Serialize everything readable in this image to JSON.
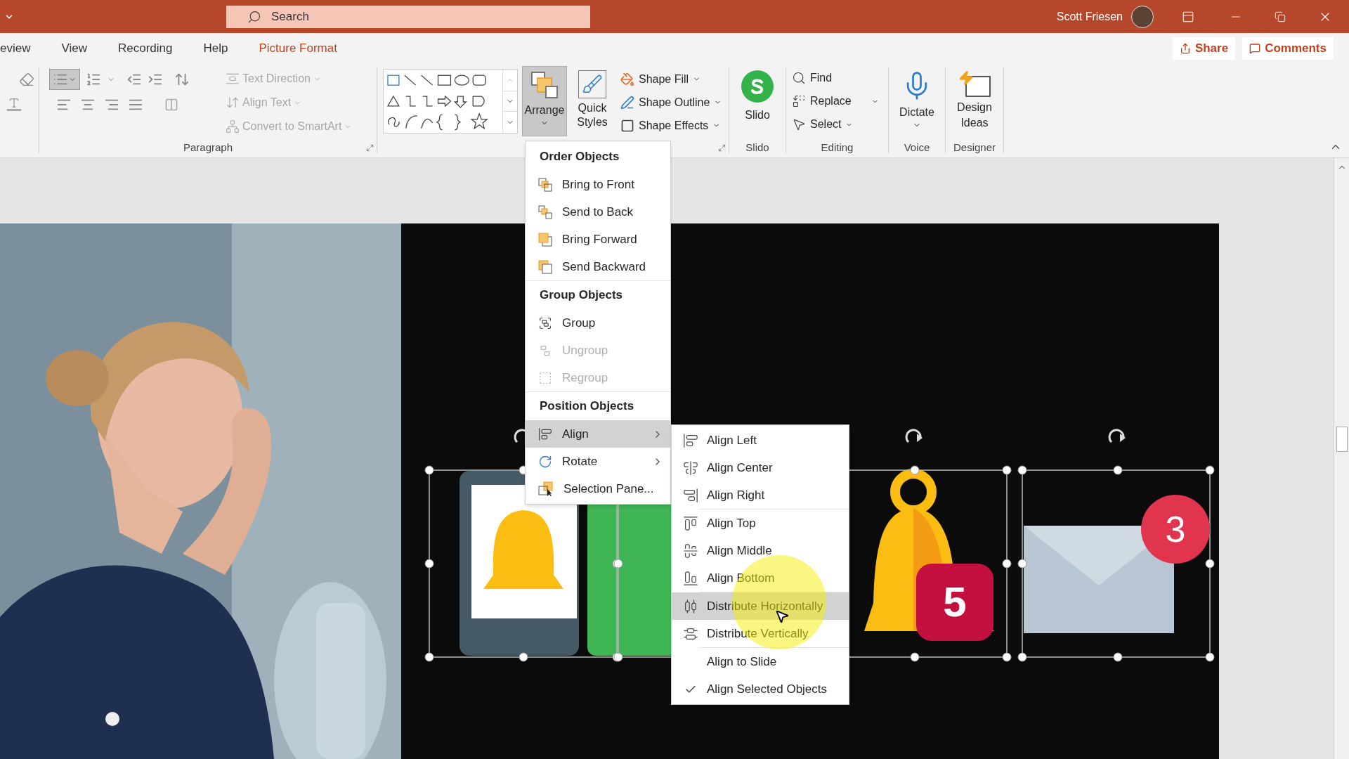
{
  "title_bar": {
    "search": {
      "placeholder": "Search"
    },
    "user_name": "Scott Friesen"
  },
  "tabs": [
    {
      "label": "eview",
      "selected": false
    },
    {
      "label": "View",
      "selected": false
    },
    {
      "label": "Recording",
      "selected": false
    },
    {
      "label": "Help",
      "selected": false
    },
    {
      "label": "Picture Format",
      "selected": true
    }
  ],
  "share_button": "Share",
  "comments_button": "Comments",
  "ribbon": {
    "paragraph": {
      "label": "Paragraph",
      "bullets": {
        "on": true
      },
      "commands": [
        {
          "label": "Text Direction",
          "disabled": true
        },
        {
          "label": "Align Text",
          "disabled": true
        },
        {
          "label": "Convert to SmartArt",
          "disabled": true
        }
      ]
    },
    "drawing": {
      "arrange": {
        "label": "Arrange",
        "expanded": true
      },
      "quick_styles": "Quick Styles",
      "shape_commands": [
        "Shape Fill",
        "Shape Outline",
        "Shape Effects"
      ]
    },
    "slido": {
      "button": "Slido",
      "label": "Slido"
    },
    "editing": {
      "commands": [
        "Find",
        "Replace",
        "Select"
      ],
      "label": "Editing"
    },
    "voice": {
      "button": "Dictate",
      "label": "Voice"
    },
    "designer": {
      "button": "Design Ideas",
      "label": "Designer"
    }
  },
  "slide": {
    "bell_badge": "5",
    "envelope_badge": "3"
  },
  "arrange_menu": {
    "sections": [
      {
        "heading": "Order Objects",
        "items": [
          {
            "label": "Bring to Front",
            "disabled": false,
            "selected": false,
            "submenu": false
          },
          {
            "label": "Send to Back",
            "disabled": false,
            "selected": false,
            "submenu": false
          },
          {
            "label": "Bring Forward",
            "disabled": false,
            "selected": false,
            "submenu": false
          },
          {
            "label": "Send Backward",
            "disabled": false,
            "selected": false,
            "submenu": false
          }
        ]
      },
      {
        "heading": "Group Objects",
        "items": [
          {
            "label": "Group",
            "disabled": false,
            "selected": false,
            "submenu": false
          },
          {
            "label": "Ungroup",
            "disabled": true,
            "selected": false,
            "submenu": false
          },
          {
            "label": "Regroup",
            "disabled": true,
            "selected": false,
            "submenu": false
          }
        ]
      },
      {
        "heading": "Position Objects",
        "items": [
          {
            "label": "Align",
            "disabled": false,
            "selected": true,
            "submenu": true
          },
          {
            "label": "Rotate",
            "disabled": false,
            "selected": false,
            "submenu": true
          },
          {
            "label": "Selection Pane...",
            "disabled": false,
            "selected": false,
            "submenu": false
          }
        ]
      }
    ]
  },
  "align_submenu": {
    "groups": [
      {
        "items": [
          {
            "label": "Align Left",
            "selected": false,
            "checked": false
          },
          {
            "label": "Align Center",
            "selected": false,
            "checked": false
          },
          {
            "label": "Align Right",
            "selected": false,
            "checked": false
          }
        ]
      },
      {
        "items": [
          {
            "label": "Align Top",
            "selected": false,
            "checked": false
          },
          {
            "label": "Align Middle",
            "selected": false,
            "checked": false
          },
          {
            "label": "Align Bottom",
            "selected": false,
            "checked": false
          }
        ]
      },
      {
        "items": [
          {
            "label": "Distribute Horizontally",
            "selected": true,
            "checked": false
          },
          {
            "label": "Distribute Vertically",
            "selected": false,
            "checked": false
          }
        ]
      },
      {
        "items": [
          {
            "label": "Align to Slide",
            "selected": false,
            "checked": false
          },
          {
            "label": "Align Selected Objects",
            "selected": false,
            "checked": true
          }
        ]
      }
    ]
  }
}
